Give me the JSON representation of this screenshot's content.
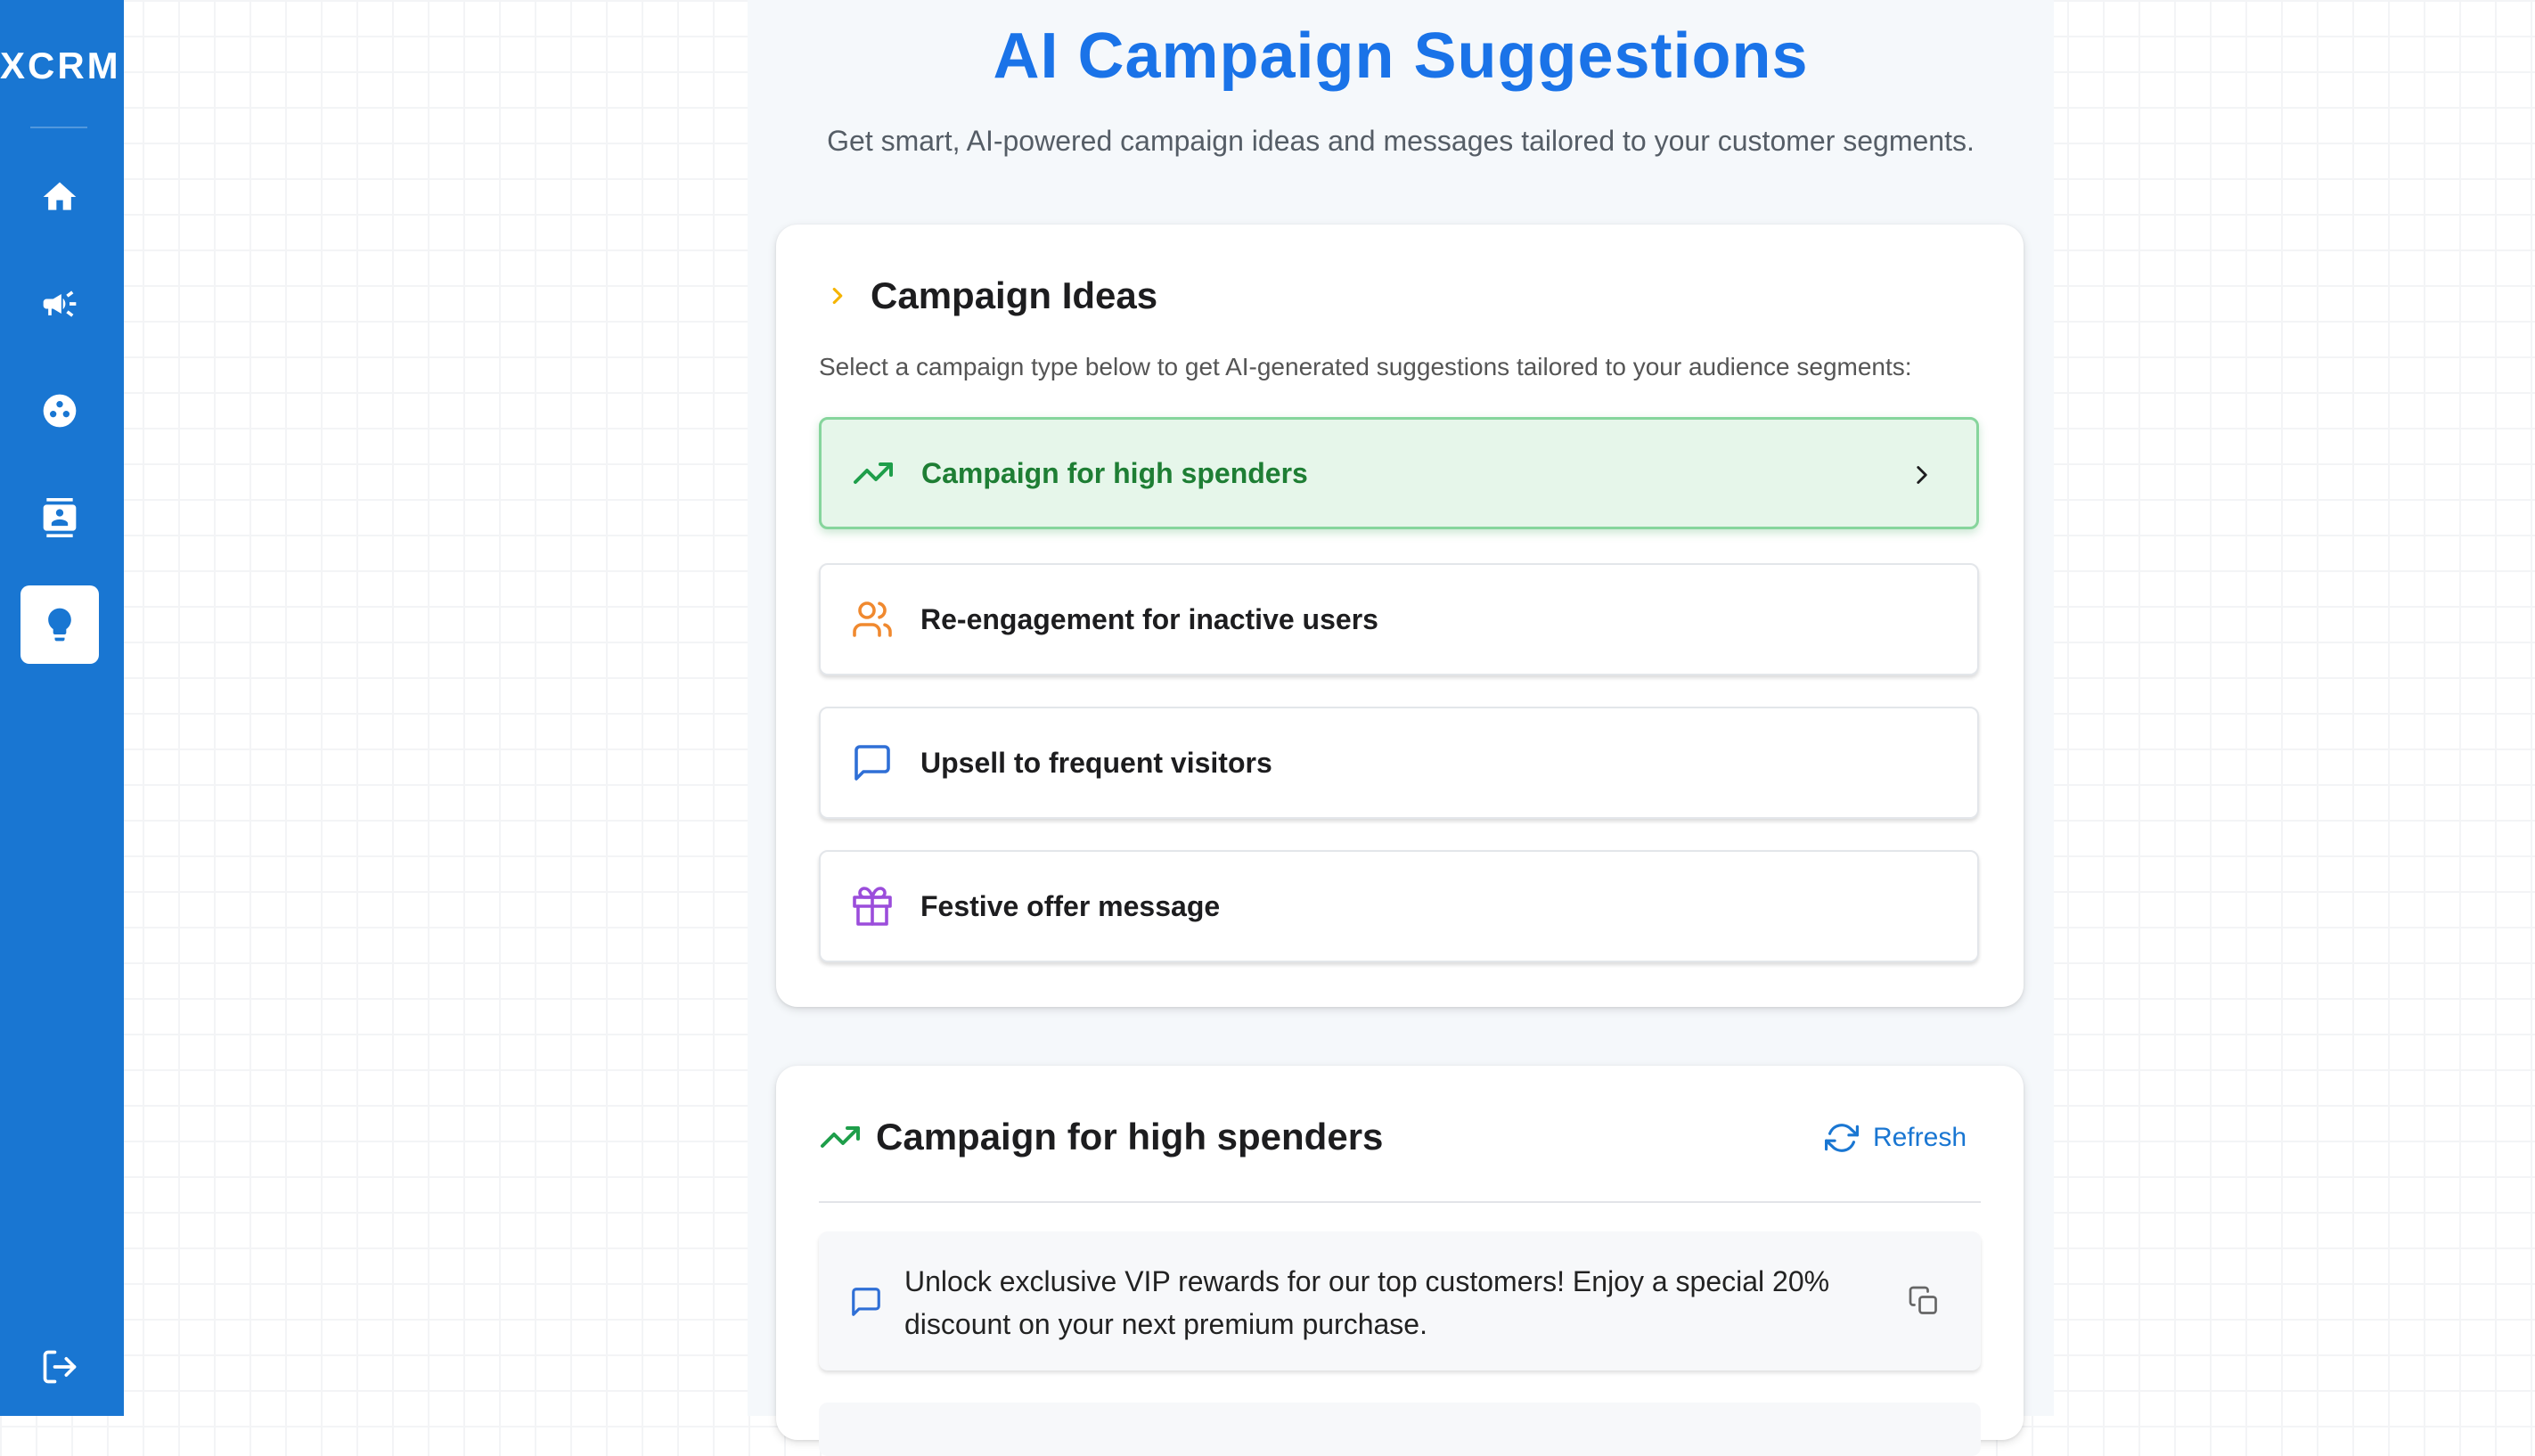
{
  "app": {
    "brand": "XCRM"
  },
  "sidebar": {
    "items": [
      {
        "name": "home-icon"
      },
      {
        "name": "megaphone-icon"
      },
      {
        "name": "segments-icon"
      },
      {
        "name": "contacts-icon"
      },
      {
        "name": "lightbulb-icon",
        "active": true
      }
    ],
    "bottom": {
      "name": "logout-icon"
    }
  },
  "header": {
    "title": "AI Campaign Suggestions",
    "subtitle": "Get smart, AI-powered campaign ideas and messages tailored to your customer segments."
  },
  "ideas": {
    "title": "Campaign Ideas",
    "description": "Select a campaign type below to get AI-generated suggestions tailored to your audience segments:",
    "options": [
      {
        "label": "Campaign for high spenders",
        "icon": "trending-up-icon",
        "color": "#1e9e4a",
        "selected": true
      },
      {
        "label": "Re-engagement for inactive users",
        "icon": "users-icon",
        "color": "#f0892f"
      },
      {
        "label": "Upsell to frequent visitors",
        "icon": "message-icon",
        "color": "#2f6fd6"
      },
      {
        "label": "Festive offer message",
        "icon": "gift-icon",
        "color": "#9b4ddb"
      }
    ]
  },
  "result": {
    "title": "Campaign for high spenders",
    "refresh_label": "Refresh",
    "messages": [
      {
        "text": "Unlock exclusive VIP rewards for our top customers! Enjoy a special 20% discount on your next premium purchase."
      }
    ]
  },
  "colors": {
    "sidebar": "#1976d2",
    "accent": "#1a73e8",
    "selected_bg": "#e6f6ea",
    "selected_text": "#1e7e34"
  }
}
